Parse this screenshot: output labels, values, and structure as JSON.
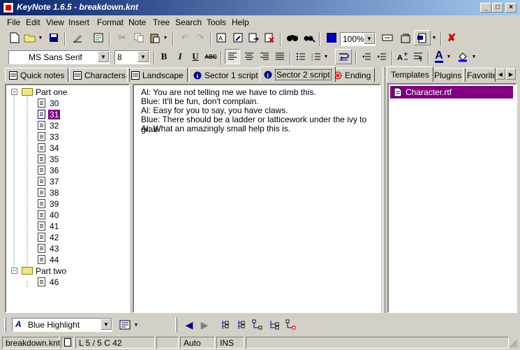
{
  "window": {
    "title": "KeyNote 1.6.5 - breakdown.knt",
    "buttons": {
      "minimize": "_",
      "maximize": "□",
      "close": "×"
    }
  },
  "menu": [
    "File",
    "Edit",
    "View",
    "Insert",
    "Format",
    "Note",
    "Tree",
    "Search",
    "Tools",
    "Help"
  ],
  "toolbar": {
    "zoom": "100%",
    "font_name": "MS Sans Serif",
    "font_size": "8",
    "bold": "B",
    "italic": "I",
    "underline": "U",
    "strike": "ABC",
    "font_color_glyph": "A"
  },
  "tabs": [
    {
      "label": "Quick notes"
    },
    {
      "label": "Characters"
    },
    {
      "label": "Landscape"
    },
    {
      "label": "Sector 1 script"
    },
    {
      "label": "Sector 2 script",
      "active": true
    },
    {
      "label": "Ending"
    }
  ],
  "tree": {
    "part_one": "Part one",
    "part_one_items": [
      "30",
      "31",
      "32",
      "33",
      "34",
      "35",
      "36",
      "37",
      "38",
      "39",
      "40",
      "41",
      "42",
      "43",
      "44"
    ],
    "selected": "31",
    "part_two": "Part two",
    "part_two_items": [
      "46"
    ],
    "expander_glyph": "−"
  },
  "editor": {
    "lines": [
      "Al: You are not telling me we have to climb this.",
      "Blue: It'll be fun, don't complain.",
      "Al: Easy for you to say, you have claws.",
      "Blue: There should be a ladder or latticework under the ivy to grab.",
      "Al: What an amazingly small help this is."
    ]
  },
  "resource_panel": {
    "tabs": [
      "Templates",
      "Plugins",
      "Favorite"
    ],
    "items": [
      "Character.rtf"
    ]
  },
  "bottom": {
    "style": "Blue Highlight"
  },
  "status": {
    "file": "breakdown.knt",
    "position": "L 5 / 5  C 42",
    "mode": "Auto",
    "insert": "INS"
  }
}
